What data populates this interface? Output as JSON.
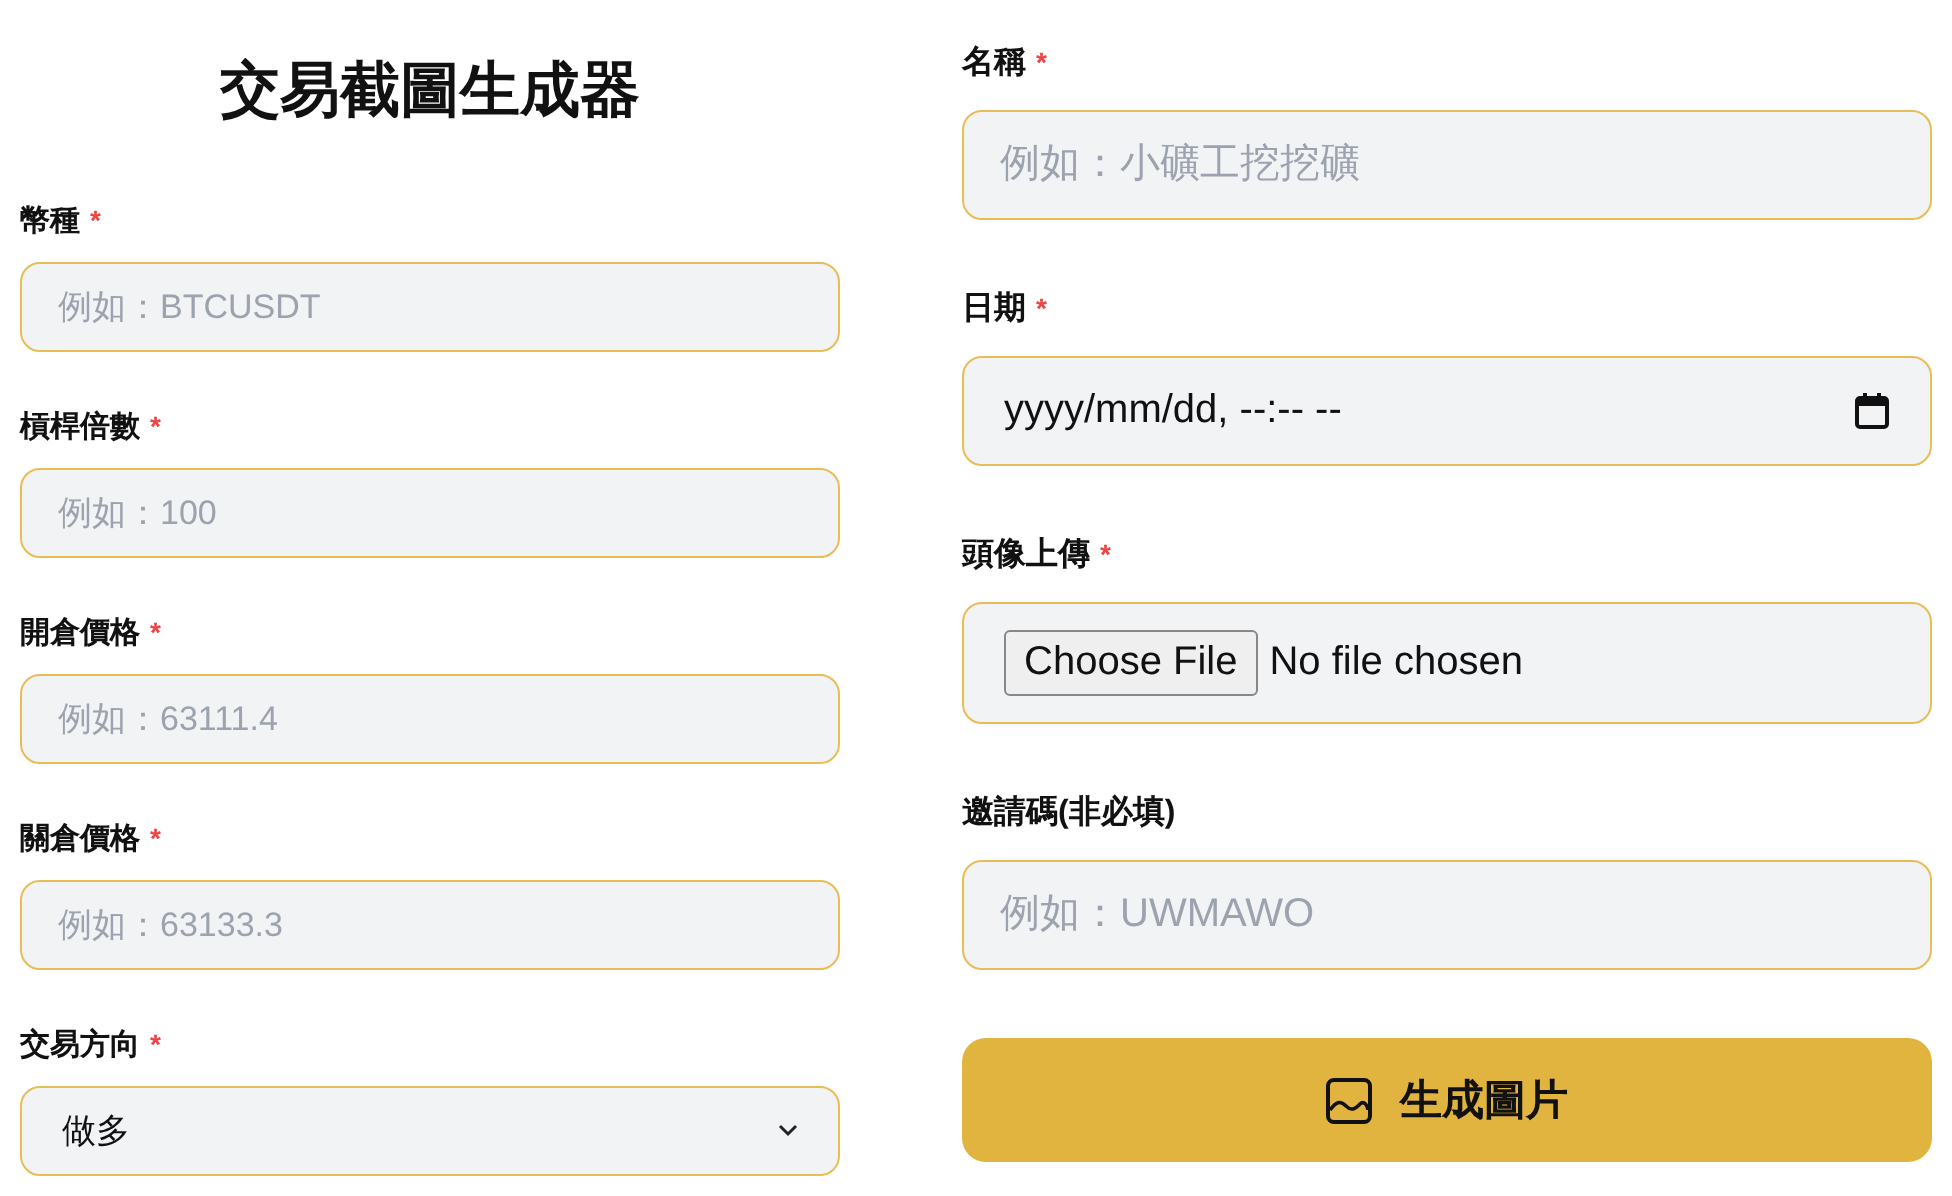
{
  "title": "交易截圖生成器",
  "left_fields": [
    {
      "kind": "text",
      "label": "幣種",
      "required_mark": "*",
      "placeholder": "例如：BTCUSDT"
    },
    {
      "kind": "text",
      "label": "槓桿倍數",
      "required_mark": "*",
      "placeholder": "例如：100"
    },
    {
      "kind": "text",
      "label": "開倉價格",
      "required_mark": "*",
      "placeholder": "例如：63111.4"
    },
    {
      "kind": "text",
      "label": "關倉價格",
      "required_mark": "*",
      "placeholder": "例如：63133.3"
    },
    {
      "kind": "select",
      "label": "交易方向",
      "required_mark": "*",
      "value": "做多"
    }
  ],
  "right_fields": [
    {
      "kind": "text",
      "label": "名稱",
      "required_mark": "*",
      "placeholder": "例如：小礦工挖挖礦"
    },
    {
      "kind": "datetime",
      "label": "日期",
      "required_mark": "*",
      "value": "yyyy/mm/dd, --:-- --"
    },
    {
      "kind": "file",
      "label": "頭像上傳",
      "required_mark": "*",
      "button": "Choose File",
      "status": "No file chosen"
    },
    {
      "kind": "text",
      "label": "邀請碼(非必填)",
      "placeholder": "例如：UWMAWO"
    }
  ],
  "submit": {
    "label": "生成圖片"
  }
}
